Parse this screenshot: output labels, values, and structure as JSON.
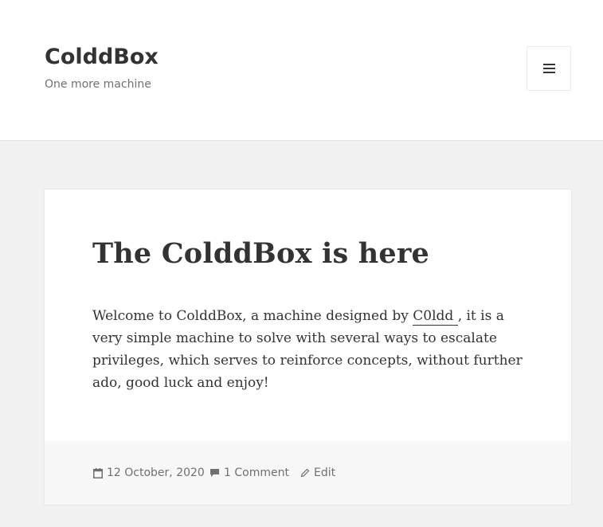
{
  "site": {
    "title": "ColddBox",
    "description": "One more machine"
  },
  "header": {
    "menu_toggle": "menu-icon"
  },
  "post": {
    "title": "The ColddBox is here",
    "content_before_link": "Welcome to ColddBox, a machine designed by ",
    "author_link": "C0ldd ",
    "content_after_link": ", it is a very simple machine to solve with several ways to escalate privileges, which serves to reinforce concepts, without further ado, good luck and enjoy!"
  },
  "footer": {
    "date": "12 October, 2020",
    "comments": "1 Comment",
    "edit": "Edit",
    "icons": {
      "date": "calendar-icon",
      "comments": "comment-icon",
      "edit": "pencil-icon"
    }
  },
  "colors": {
    "text": "#333333",
    "meta": "#707070",
    "background": "#f1f1f1"
  }
}
